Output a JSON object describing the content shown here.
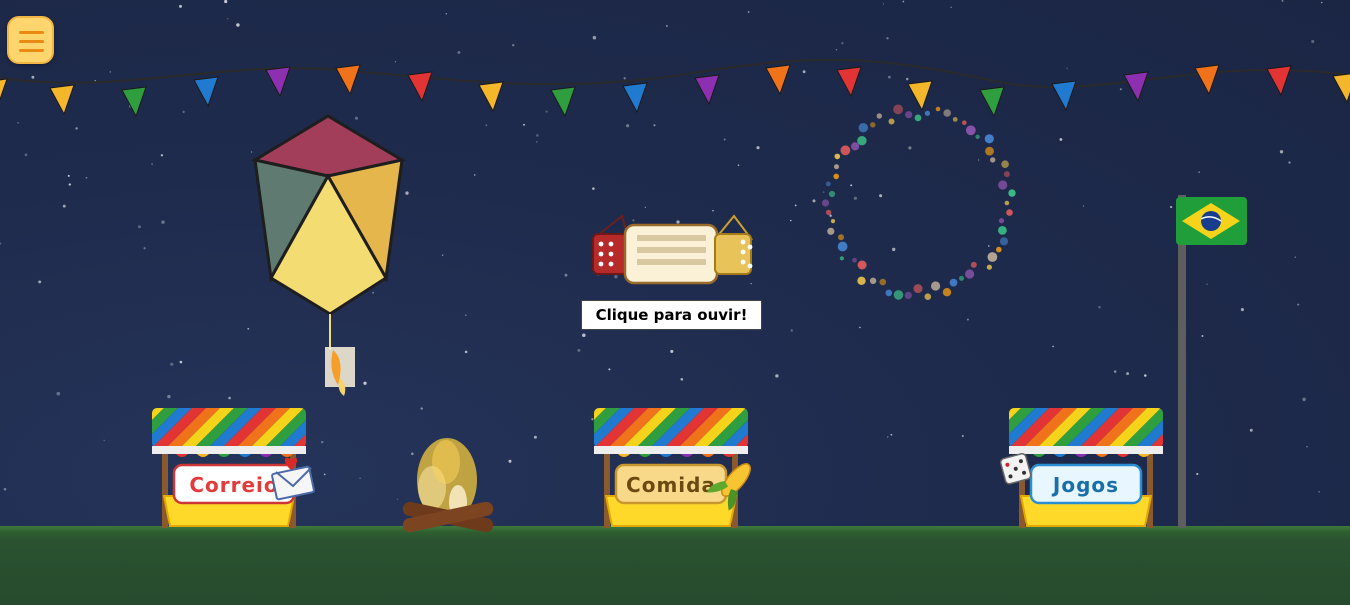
{
  "menu": {
    "icon": "hamburger-icon"
  },
  "accordion": {
    "label": "Clique para ouvir!",
    "icon": "accordion-icon"
  },
  "stalls": [
    {
      "label": "Correio",
      "icon": "love-letter-icon",
      "text_color": "#e23b3b"
    },
    {
      "label": "Comida",
      "icon": "corn-icon",
      "text_color": "#6b4a12"
    },
    {
      "label": "Jogos",
      "icon": "dice-icon",
      "text_color": "#1a6fa8"
    }
  ],
  "flag": {
    "icon": "brazil-flag-icon",
    "colors": [
      "#1f9e3a",
      "#f4d31a",
      "#173d8f"
    ]
  },
  "decor": {
    "balloon": "paper-balloon-icon",
    "bonfire": "bonfire-icon",
    "fireworks": "firework-ring-icon",
    "bunting": "bunting-flags"
  },
  "colors": {
    "sky": "#1c2746",
    "ground": "#2b5530",
    "menu_button": "#ffd66e",
    "bunting": [
      "#f4b62a",
      "#2e9e3e",
      "#1f7ad0",
      "#8d2fb1",
      "#f0721a",
      "#e23434"
    ]
  }
}
